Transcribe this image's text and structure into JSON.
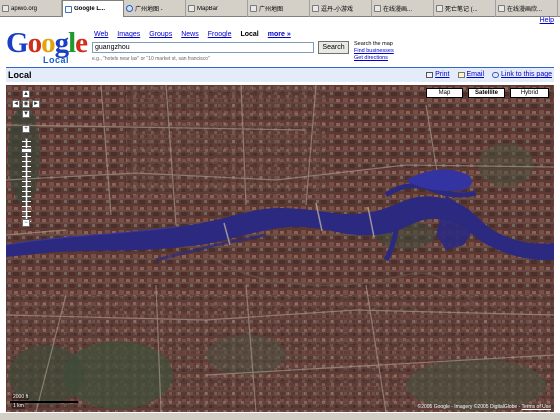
{
  "browser": {
    "tabs": [
      {
        "label": "apiwo.org",
        "icon": "page-icon",
        "active": false
      },
      {
        "label": "Google L...",
        "icon": "google-icon",
        "active": true
      },
      {
        "label": "广州地图 -",
        "icon": "ie-icon",
        "active": false
      },
      {
        "label": "MapBar",
        "icon": "page-icon",
        "active": false
      },
      {
        "label": "广州地图",
        "icon": "page-icon",
        "active": false
      },
      {
        "label": "逗丹-小游戏",
        "icon": "page-icon",
        "active": false
      },
      {
        "label": "在线漫画...",
        "icon": "page-icon",
        "active": false
      },
      {
        "label": "死亡笔记 (...",
        "icon": "page-icon",
        "active": false
      },
      {
        "label": "在线漫画欣...",
        "icon": "page-icon",
        "active": false
      }
    ]
  },
  "header": {
    "logo_main": "Google",
    "logo_sub": "Local",
    "help": "Help",
    "nav": [
      {
        "label": "Web",
        "current": false
      },
      {
        "label": "Images",
        "current": false
      },
      {
        "label": "Groups",
        "current": false
      },
      {
        "label": "News",
        "current": false
      },
      {
        "label": "Froogle",
        "current": false
      },
      {
        "label": "Local",
        "current": true
      },
      {
        "label": "more »",
        "current": false
      }
    ],
    "search": {
      "value": "guangzhou",
      "button": "Search",
      "hint": "e.g., \"hotels near lax\" or \"10 market st, san francisco\""
    },
    "side": {
      "title": "Search the map",
      "find": "Find businesses",
      "directions": "Get directions"
    }
  },
  "section": {
    "title": "Local",
    "print": "Print",
    "email": "Email",
    "link": "Link to this page"
  },
  "map": {
    "types": [
      {
        "label": "Map",
        "selected": false
      },
      {
        "label": "Satellite",
        "selected": true
      },
      {
        "label": "Hybrid",
        "selected": false
      }
    ],
    "controls": {
      "up": "▲",
      "left": "◄",
      "center": "◉",
      "right": "►",
      "down": "▼",
      "zoom_in": "+",
      "zoom_out": "−"
    },
    "zoom_level_fraction": 0.12,
    "scale": {
      "label_top": "2000 ft",
      "label_bottom": "1 km"
    },
    "copyright": "©2005 Google - Imagery ©2005 DigitalGlobe -",
    "terms": "Terms of Use",
    "colors": {
      "river": "#2b2a80",
      "urban": "#5e3b34",
      "greenery": "#43503a",
      "water_bright": "#3433a2"
    }
  }
}
